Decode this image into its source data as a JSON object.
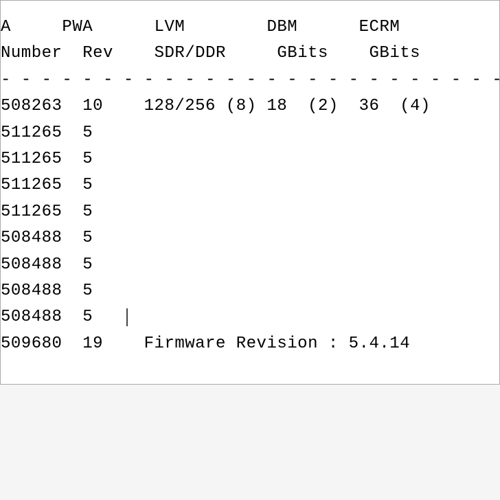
{
  "header1": {
    "col_a": "A",
    "col_pwa": "PWA",
    "col_lvm": "LVM",
    "col_dbm": "DBM",
    "col_ecrm": "ECRM"
  },
  "header2": {
    "col_number": "Number",
    "col_rev": "Rev",
    "col_sdrddr": "SDR/DDR",
    "col_gbits1": "GBits",
    "col_gbits2": "GBits"
  },
  "separator": "- - - - - - - - - - - - - - - - - - - - - - - - - - - - - - - - - - - -",
  "rows": [
    {
      "number": "508263",
      "rev": "10",
      "lvm": "128/256 (8)",
      "dbm": "18  (2)",
      "ecrm": "36  (4)"
    },
    {
      "number": "511265",
      "rev": "5",
      "lvm": "",
      "dbm": "",
      "ecrm": ""
    },
    {
      "number": "511265",
      "rev": "5",
      "lvm": "",
      "dbm": "",
      "ecrm": ""
    },
    {
      "number": "511265",
      "rev": "5",
      "lvm": "",
      "dbm": "",
      "ecrm": ""
    },
    {
      "number": "511265",
      "rev": "5",
      "lvm": "",
      "dbm": "",
      "ecrm": ""
    },
    {
      "number": "508488",
      "rev": "5",
      "lvm": "",
      "dbm": "",
      "ecrm": ""
    },
    {
      "number": "508488",
      "rev": "5",
      "lvm": "",
      "dbm": "",
      "ecrm": ""
    },
    {
      "number": "508488",
      "rev": "5",
      "lvm": "",
      "dbm": "",
      "ecrm": ""
    },
    {
      "number": "508488",
      "rev": "5",
      "lvm": "",
      "dbm": "",
      "ecrm": "",
      "cursor": true
    },
    {
      "number": "509680",
      "rev": "19",
      "lvm": "Firmware Revision : 5.4.14",
      "dbm": "",
      "ecrm": ""
    }
  ]
}
